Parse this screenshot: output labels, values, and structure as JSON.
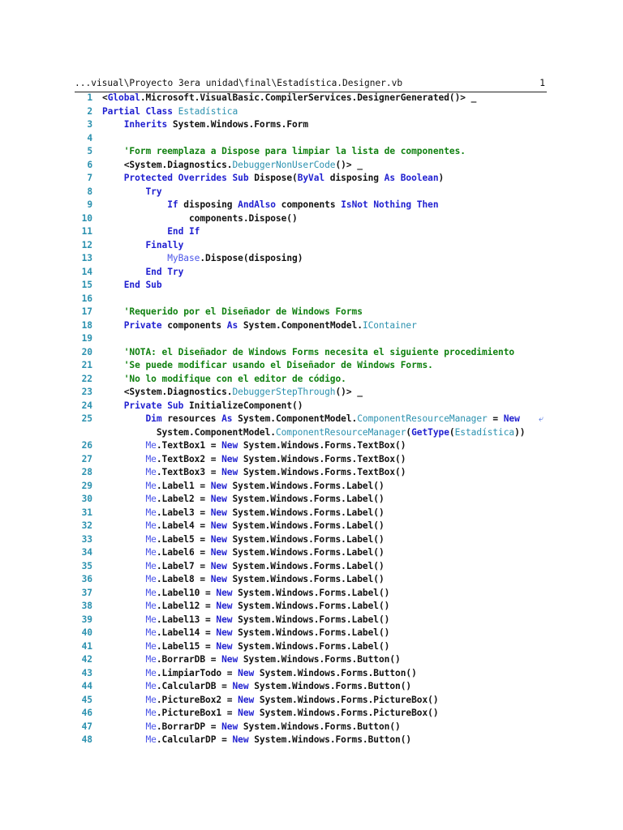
{
  "header": {
    "path": "...visual\\Proyecto 3era unidad\\final\\Estadística.Designer.vb",
    "page": "1"
  },
  "wrap_icon": "⤶",
  "lines": [
    {
      "n": "1",
      "ind": 0,
      "tokens": [
        [
          "p",
          "<"
        ],
        [
          "k",
          "Global"
        ],
        [
          "p",
          ".Microsoft.VisualBasic.CompilerServices.DesignerGenerated()> _"
        ]
      ]
    },
    {
      "n": "2",
      "ind": 0,
      "tokens": [
        [
          "k",
          "Partial Class "
        ],
        [
          "t",
          "Estadística"
        ]
      ]
    },
    {
      "n": "3",
      "ind": 1,
      "tokens": [
        [
          "k",
          "Inherits"
        ],
        [
          "p",
          " System.Windows.Forms.Form"
        ]
      ]
    },
    {
      "n": "4",
      "ind": 0,
      "tokens": []
    },
    {
      "n": "5",
      "ind": 1,
      "tokens": [
        [
          "c",
          "'Form reemplaza a Dispose para limpiar la lista de componentes."
        ]
      ]
    },
    {
      "n": "6",
      "ind": 1,
      "tokens": [
        [
          "p",
          "<System.Diagnostics."
        ],
        [
          "t",
          "DebuggerNonUserCode"
        ],
        [
          "p",
          "()> _"
        ]
      ]
    },
    {
      "n": "7",
      "ind": 1,
      "tokens": [
        [
          "k",
          "Protected Overrides Sub"
        ],
        [
          "p",
          " Dispose("
        ],
        [
          "k",
          "ByVal"
        ],
        [
          "p",
          " disposing "
        ],
        [
          "k",
          "As Boolean"
        ],
        [
          "p",
          ")"
        ]
      ]
    },
    {
      "n": "8",
      "ind": 2,
      "tokens": [
        [
          "k",
          "Try"
        ]
      ]
    },
    {
      "n": "9",
      "ind": 3,
      "tokens": [
        [
          "k",
          "If"
        ],
        [
          "p",
          " disposing "
        ],
        [
          "k",
          "AndAlso"
        ],
        [
          "p",
          " components "
        ],
        [
          "k",
          "IsNot Nothing Then"
        ]
      ]
    },
    {
      "n": "10",
      "ind": 4,
      "tokens": [
        [
          "p",
          "components.Dispose()"
        ]
      ]
    },
    {
      "n": "11",
      "ind": 3,
      "tokens": [
        [
          "k",
          "End If"
        ]
      ]
    },
    {
      "n": "12",
      "ind": 2,
      "tokens": [
        [
          "k",
          "Finally"
        ]
      ]
    },
    {
      "n": "13",
      "ind": 3,
      "tokens": [
        [
          "m",
          "MyBase"
        ],
        [
          "p",
          ".Dispose(disposing)"
        ]
      ]
    },
    {
      "n": "14",
      "ind": 2,
      "tokens": [
        [
          "k",
          "End Try"
        ]
      ]
    },
    {
      "n": "15",
      "ind": 1,
      "tokens": [
        [
          "k",
          "End Sub"
        ]
      ]
    },
    {
      "n": "16",
      "ind": 0,
      "tokens": []
    },
    {
      "n": "17",
      "ind": 1,
      "tokens": [
        [
          "c",
          "'Requerido por el Diseñador de Windows Forms"
        ]
      ]
    },
    {
      "n": "18",
      "ind": 1,
      "tokens": [
        [
          "k",
          "Private"
        ],
        [
          "p",
          " components "
        ],
        [
          "k",
          "As"
        ],
        [
          "p",
          " System.ComponentModel."
        ],
        [
          "t",
          "IContainer"
        ]
      ]
    },
    {
      "n": "19",
      "ind": 0,
      "tokens": []
    },
    {
      "n": "20",
      "ind": 1,
      "tokens": [
        [
          "c",
          "'NOTA: el Diseñador de Windows Forms necesita el siguiente procedimiento"
        ]
      ]
    },
    {
      "n": "21",
      "ind": 1,
      "tokens": [
        [
          "c",
          "'Se puede modificar usando el Diseñador de Windows Forms."
        ]
      ]
    },
    {
      "n": "22",
      "ind": 1,
      "tokens": [
        [
          "c",
          "'No lo modifique con el editor de código."
        ]
      ]
    },
    {
      "n": "23",
      "ind": 1,
      "tokens": [
        [
          "p",
          "<System.Diagnostics."
        ],
        [
          "t",
          "DebuggerStepThrough"
        ],
        [
          "p",
          "()> _"
        ]
      ]
    },
    {
      "n": "24",
      "ind": 1,
      "tokens": [
        [
          "k",
          "Private Sub"
        ],
        [
          "p",
          " InitializeComponent()"
        ]
      ]
    },
    {
      "n": "25",
      "ind": 2,
      "tokens": [
        [
          "k",
          "Dim"
        ],
        [
          "p",
          " resources "
        ],
        [
          "k",
          "As"
        ],
        [
          "p",
          " System.ComponentModel."
        ],
        [
          "t",
          "ComponentResourceManager"
        ],
        [
          "p",
          " = "
        ],
        [
          "k",
          "New"
        ]
      ],
      "cont": [
        [
          "p",
          "  System.ComponentModel."
        ],
        [
          "t",
          "ComponentResourceManager"
        ],
        [
          "p",
          "("
        ],
        [
          "k",
          "GetType"
        ],
        [
          "p",
          "("
        ],
        [
          "t",
          "Estadística"
        ],
        [
          "p",
          "))"
        ]
      ]
    },
    {
      "n": "26",
      "ind": 2,
      "tokens": [
        [
          "m",
          "Me"
        ],
        [
          "p",
          ".TextBox1 = "
        ],
        [
          "k",
          "New"
        ],
        [
          "p",
          " System.Windows.Forms.TextBox()"
        ]
      ]
    },
    {
      "n": "27",
      "ind": 2,
      "tokens": [
        [
          "m",
          "Me"
        ],
        [
          "p",
          ".TextBox2 = "
        ],
        [
          "k",
          "New"
        ],
        [
          "p",
          " System.Windows.Forms.TextBox()"
        ]
      ]
    },
    {
      "n": "28",
      "ind": 2,
      "tokens": [
        [
          "m",
          "Me"
        ],
        [
          "p",
          ".TextBox3 = "
        ],
        [
          "k",
          "New"
        ],
        [
          "p",
          " System.Windows.Forms.TextBox()"
        ]
      ]
    },
    {
      "n": "29",
      "ind": 2,
      "tokens": [
        [
          "m",
          "Me"
        ],
        [
          "p",
          ".Label1 = "
        ],
        [
          "k",
          "New"
        ],
        [
          "p",
          " System.Windows.Forms.Label()"
        ]
      ]
    },
    {
      "n": "30",
      "ind": 2,
      "tokens": [
        [
          "m",
          "Me"
        ],
        [
          "p",
          ".Label2 = "
        ],
        [
          "k",
          "New"
        ],
        [
          "p",
          " System.Windows.Forms.Label()"
        ]
      ]
    },
    {
      "n": "31",
      "ind": 2,
      "tokens": [
        [
          "m",
          "Me"
        ],
        [
          "p",
          ".Label3 = "
        ],
        [
          "k",
          "New"
        ],
        [
          "p",
          " System.Windows.Forms.Label()"
        ]
      ]
    },
    {
      "n": "32",
      "ind": 2,
      "tokens": [
        [
          "m",
          "Me"
        ],
        [
          "p",
          ".Label4 = "
        ],
        [
          "k",
          "New"
        ],
        [
          "p",
          " System.Windows.Forms.Label()"
        ]
      ]
    },
    {
      "n": "33",
      "ind": 2,
      "tokens": [
        [
          "m",
          "Me"
        ],
        [
          "p",
          ".Label5 = "
        ],
        [
          "k",
          "New"
        ],
        [
          "p",
          " System.Windows.Forms.Label()"
        ]
      ]
    },
    {
      "n": "34",
      "ind": 2,
      "tokens": [
        [
          "m",
          "Me"
        ],
        [
          "p",
          ".Label6 = "
        ],
        [
          "k",
          "New"
        ],
        [
          "p",
          " System.Windows.Forms.Label()"
        ]
      ]
    },
    {
      "n": "35",
      "ind": 2,
      "tokens": [
        [
          "m",
          "Me"
        ],
        [
          "p",
          ".Label7 = "
        ],
        [
          "k",
          "New"
        ],
        [
          "p",
          " System.Windows.Forms.Label()"
        ]
      ]
    },
    {
      "n": "36",
      "ind": 2,
      "tokens": [
        [
          "m",
          "Me"
        ],
        [
          "p",
          ".Label8 = "
        ],
        [
          "k",
          "New"
        ],
        [
          "p",
          " System.Windows.Forms.Label()"
        ]
      ]
    },
    {
      "n": "37",
      "ind": 2,
      "tokens": [
        [
          "m",
          "Me"
        ],
        [
          "p",
          ".Label10 = "
        ],
        [
          "k",
          "New"
        ],
        [
          "p",
          " System.Windows.Forms.Label()"
        ]
      ]
    },
    {
      "n": "38",
      "ind": 2,
      "tokens": [
        [
          "m",
          "Me"
        ],
        [
          "p",
          ".Label12 = "
        ],
        [
          "k",
          "New"
        ],
        [
          "p",
          " System.Windows.Forms.Label()"
        ]
      ]
    },
    {
      "n": "39",
      "ind": 2,
      "tokens": [
        [
          "m",
          "Me"
        ],
        [
          "p",
          ".Label13 = "
        ],
        [
          "k",
          "New"
        ],
        [
          "p",
          " System.Windows.Forms.Label()"
        ]
      ]
    },
    {
      "n": "40",
      "ind": 2,
      "tokens": [
        [
          "m",
          "Me"
        ],
        [
          "p",
          ".Label14 = "
        ],
        [
          "k",
          "New"
        ],
        [
          "p",
          " System.Windows.Forms.Label()"
        ]
      ]
    },
    {
      "n": "41",
      "ind": 2,
      "tokens": [
        [
          "m",
          "Me"
        ],
        [
          "p",
          ".Label15 = "
        ],
        [
          "k",
          "New"
        ],
        [
          "p",
          " System.Windows.Forms.Label()"
        ]
      ]
    },
    {
      "n": "42",
      "ind": 2,
      "tokens": [
        [
          "m",
          "Me"
        ],
        [
          "p",
          ".BorrarDB = "
        ],
        [
          "k",
          "New"
        ],
        [
          "p",
          " System.Windows.Forms.Button()"
        ]
      ]
    },
    {
      "n": "43",
      "ind": 2,
      "tokens": [
        [
          "m",
          "Me"
        ],
        [
          "p",
          ".LimpiarTodo = "
        ],
        [
          "k",
          "New"
        ],
        [
          "p",
          " System.Windows.Forms.Button()"
        ]
      ]
    },
    {
      "n": "44",
      "ind": 2,
      "tokens": [
        [
          "m",
          "Me"
        ],
        [
          "p",
          ".CalcularDB = "
        ],
        [
          "k",
          "New"
        ],
        [
          "p",
          " System.Windows.Forms.Button()"
        ]
      ]
    },
    {
      "n": "45",
      "ind": 2,
      "tokens": [
        [
          "m",
          "Me"
        ],
        [
          "p",
          ".PictureBox2 = "
        ],
        [
          "k",
          "New"
        ],
        [
          "p",
          " System.Windows.Forms.PictureBox()"
        ]
      ]
    },
    {
      "n": "46",
      "ind": 2,
      "tokens": [
        [
          "m",
          "Me"
        ],
        [
          "p",
          ".PictureBox1 = "
        ],
        [
          "k",
          "New"
        ],
        [
          "p",
          " System.Windows.Forms.PictureBox()"
        ]
      ]
    },
    {
      "n": "47",
      "ind": 2,
      "tokens": [
        [
          "m",
          "Me"
        ],
        [
          "p",
          ".BorrarDP = "
        ],
        [
          "k",
          "New"
        ],
        [
          "p",
          " System.Windows.Forms.Button()"
        ]
      ]
    },
    {
      "n": "48",
      "ind": 2,
      "tokens": [
        [
          "m",
          "Me"
        ],
        [
          "p",
          ".CalcularDP = "
        ],
        [
          "k",
          "New"
        ],
        [
          "p",
          " System.Windows.Forms.Button()"
        ]
      ]
    }
  ]
}
